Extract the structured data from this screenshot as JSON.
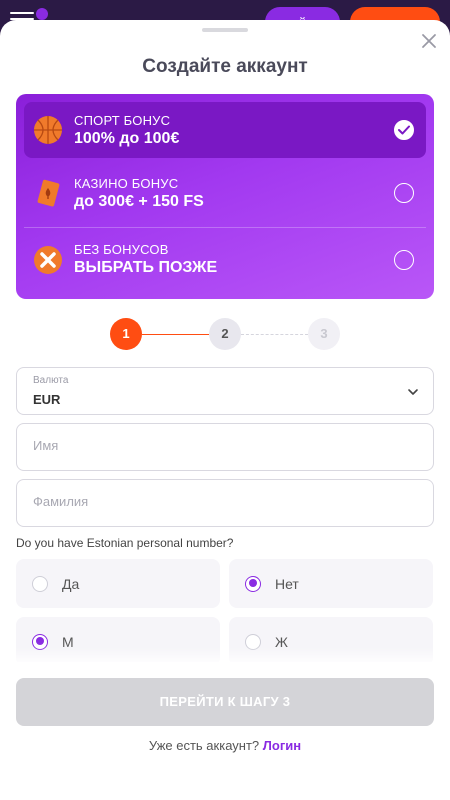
{
  "topbar": {
    "purple_button_label": "й"
  },
  "sheet": {
    "title": "Создайте аккаунт"
  },
  "bonuses": [
    {
      "label": "СПОРТ БОНУС",
      "value": "100% до 100€",
      "selected": true,
      "icon": "basketball-icon"
    },
    {
      "label": "КАЗИНО БОНУС",
      "value": "до 300€ + 150 FS",
      "selected": false,
      "icon": "playing-card-icon"
    },
    {
      "label": "БЕЗ БОНУСОВ",
      "value": "ВЫБРАТЬ ПОЗЖЕ",
      "selected": false,
      "icon": "no-bonus-icon"
    }
  ],
  "stepper": {
    "steps": [
      "1",
      "2",
      "3"
    ],
    "current": 1
  },
  "form": {
    "currency": {
      "label": "Валюта",
      "value": "EUR"
    },
    "first_name": {
      "placeholder": "Имя"
    },
    "last_name": {
      "placeholder": "Фамилия"
    },
    "personal_number_question": "Do you have Estonian personal number?",
    "personal_number_options": [
      {
        "label": "Да",
        "selected": false
      },
      {
        "label": "Нет",
        "selected": true
      }
    ],
    "gender_options": [
      {
        "label": "М",
        "selected": true
      },
      {
        "label": "Ж",
        "selected": false
      }
    ]
  },
  "footer": {
    "next_button": "ПЕРЕЙТИ К ШАГУ 3",
    "have_account": "Уже есть аккаунт?",
    "login_link": "Логин"
  },
  "colors": {
    "accent_purple": "#8a2be2",
    "accent_orange": "#ff4d12",
    "disabled_button": "#d4d4d8"
  }
}
